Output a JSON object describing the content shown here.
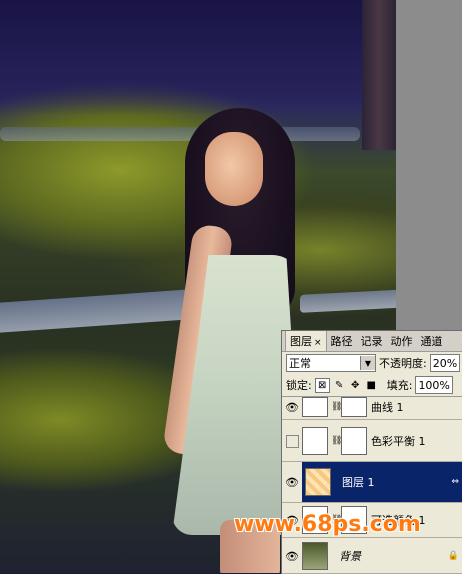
{
  "layers_panel": {
    "tabs": [
      {
        "label": "图层",
        "active": true,
        "close": "×"
      },
      {
        "label": "路径"
      },
      {
        "label": "记录"
      },
      {
        "label": "动作"
      },
      {
        "label": "通道"
      }
    ],
    "blend_mode": "正常",
    "opacity_label": "不透明度:",
    "opacity_value": "20%",
    "lock_label": "锁定:",
    "fill_label": "填充:",
    "fill_value": "100%",
    "layers": [
      {
        "name": "曲线 1",
        "visible": true,
        "selected": false
      },
      {
        "name": "色彩平衡 1",
        "visible": false,
        "selected": false
      },
      {
        "name": "图层 1",
        "visible": true,
        "selected": true
      },
      {
        "name": "可选颜色 1",
        "visible": true,
        "selected": false
      },
      {
        "name": "背景",
        "visible": true,
        "selected": false
      }
    ]
  },
  "watermark": "www.68ps.com",
  "colors": {
    "panel_bg": "#ece9d8",
    "selection": "#0a246a",
    "watermark": "#ff7b10",
    "gray_strip": "#8c8c8c"
  },
  "icons": [
    "eye-icon",
    "chain-icon",
    "lock-transparent-icon",
    "lock-brush-icon",
    "lock-move-icon",
    "lock-all-icon",
    "dropdown-arrow-icon"
  ]
}
